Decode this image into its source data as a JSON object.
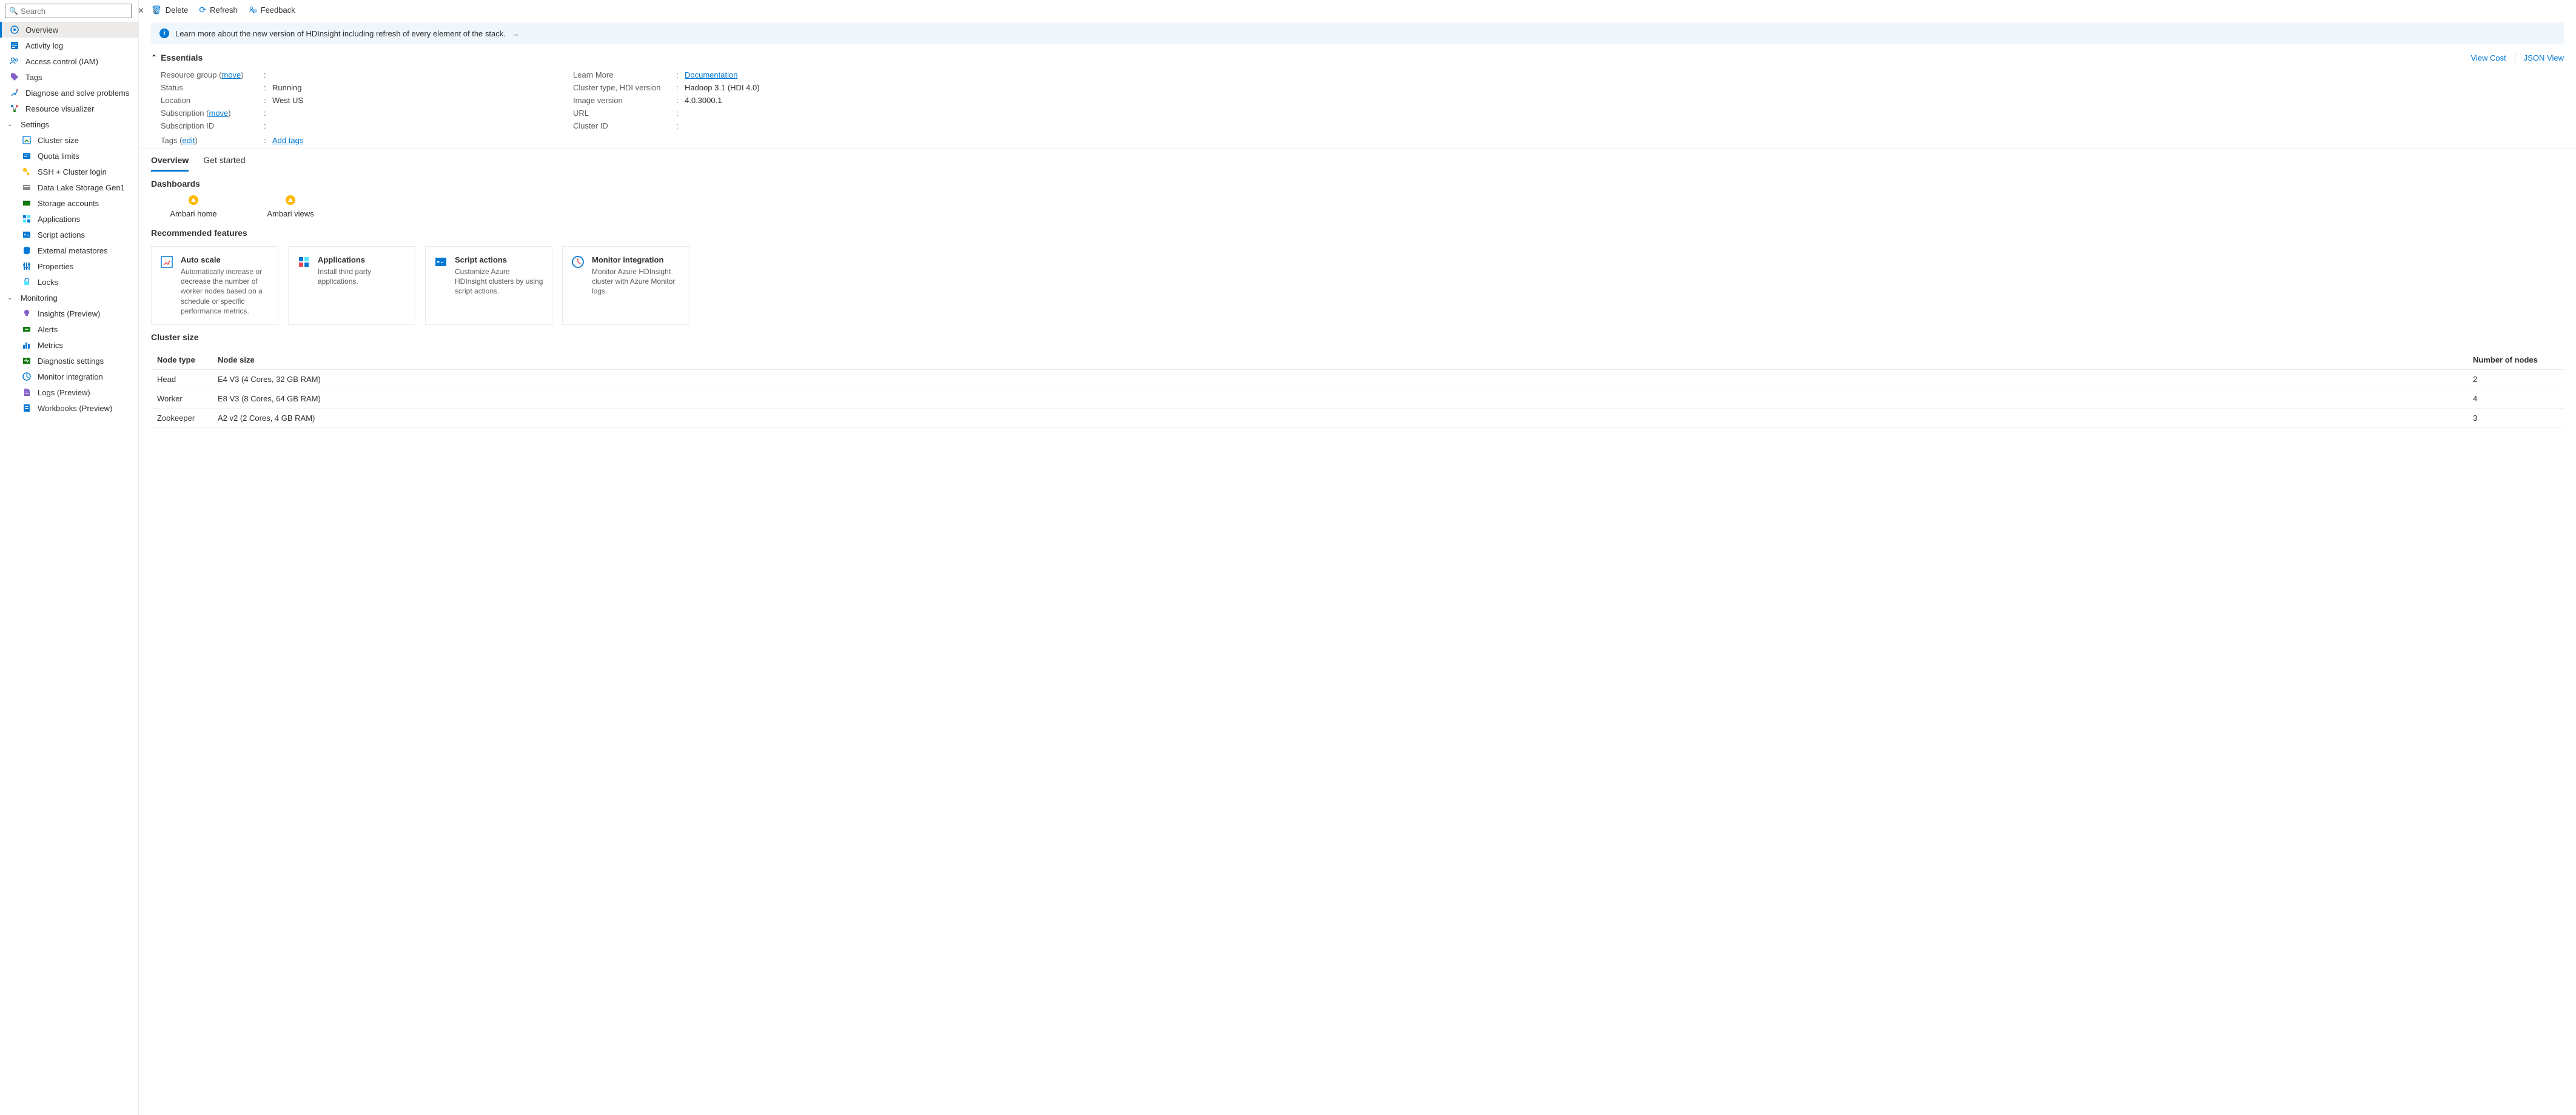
{
  "search": {
    "placeholder": "Search"
  },
  "sidebar": {
    "items": [
      {
        "label": "Overview"
      },
      {
        "label": "Activity log"
      },
      {
        "label": "Access control (IAM)"
      },
      {
        "label": "Tags"
      },
      {
        "label": "Diagnose and solve problems"
      },
      {
        "label": "Resource visualizer"
      }
    ],
    "settings_label": "Settings",
    "settings": [
      {
        "label": "Cluster size"
      },
      {
        "label": "Quota limits"
      },
      {
        "label": "SSH + Cluster login"
      },
      {
        "label": "Data Lake Storage Gen1"
      },
      {
        "label": "Storage accounts"
      },
      {
        "label": "Applications"
      },
      {
        "label": "Script actions"
      },
      {
        "label": "External metastores"
      },
      {
        "label": "Properties"
      },
      {
        "label": "Locks"
      }
    ],
    "monitoring_label": "Monitoring",
    "monitoring": [
      {
        "label": "Insights (Preview)"
      },
      {
        "label": "Alerts"
      },
      {
        "label": "Metrics"
      },
      {
        "label": "Diagnostic settings"
      },
      {
        "label": "Monitor integration"
      },
      {
        "label": "Logs (Preview)"
      },
      {
        "label": "Workbooks (Preview)"
      }
    ]
  },
  "toolbar": {
    "delete": "Delete",
    "refresh": "Refresh",
    "feedback": "Feedback"
  },
  "banner": "Learn more about the new version of HDInsight including refresh of every element of the stack.",
  "essentials": {
    "title": "Essentials",
    "view_cost": "View Cost",
    "json_view": "JSON View",
    "left": [
      {
        "label": "Resource group",
        "link": "move",
        "value": ""
      },
      {
        "label": "Status",
        "value": "Running"
      },
      {
        "label": "Location",
        "value": "West US"
      },
      {
        "label": "Subscription",
        "link": "move",
        "value": ""
      },
      {
        "label": "Subscription ID",
        "value": ""
      }
    ],
    "right": [
      {
        "label": "Learn More",
        "value": "Documentation",
        "is_link": true
      },
      {
        "label": "Cluster type, HDI version",
        "value": "Hadoop 3.1 (HDI 4.0)"
      },
      {
        "label": "Image version",
        "value": "4.0.3000.1"
      },
      {
        "label": "URL",
        "value": ""
      },
      {
        "label": "Cluster ID",
        "value": ""
      }
    ],
    "tags_label": "Tags",
    "tags_edit": "edit",
    "tags_add": "Add tags"
  },
  "tabs": {
    "overview": "Overview",
    "get_started": "Get started"
  },
  "dashboards": {
    "title": "Dashboards",
    "items": [
      {
        "label": "Ambari home"
      },
      {
        "label": "Ambari views"
      }
    ]
  },
  "features": {
    "title": "Recommended features",
    "cards": [
      {
        "title": "Auto scale",
        "desc": "Automatically increase or decrease the number of worker nodes based on a schedule or specific performance metrics."
      },
      {
        "title": "Applications",
        "desc": "Install third party applications."
      },
      {
        "title": "Script actions",
        "desc": "Customize Azure HDInsight clusters by using script actions."
      },
      {
        "title": "Monitor integration",
        "desc": "Monitor Azure HDInsight cluster with Azure Monitor logs."
      }
    ]
  },
  "cluster": {
    "title": "Cluster size",
    "headers": {
      "c1": "Node type",
      "c2": "Node size",
      "c3": "Number of nodes"
    },
    "rows": [
      {
        "c1": "Head",
        "c2": "E4 V3 (4 Cores, 32 GB RAM)",
        "c3": "2"
      },
      {
        "c1": "Worker",
        "c2": "E8 V3 (8 Cores, 64 GB RAM)",
        "c3": "4"
      },
      {
        "c1": "Zookeeper",
        "c2": "A2 v2 (2 Cores, 4 GB RAM)",
        "c3": "3"
      }
    ]
  }
}
